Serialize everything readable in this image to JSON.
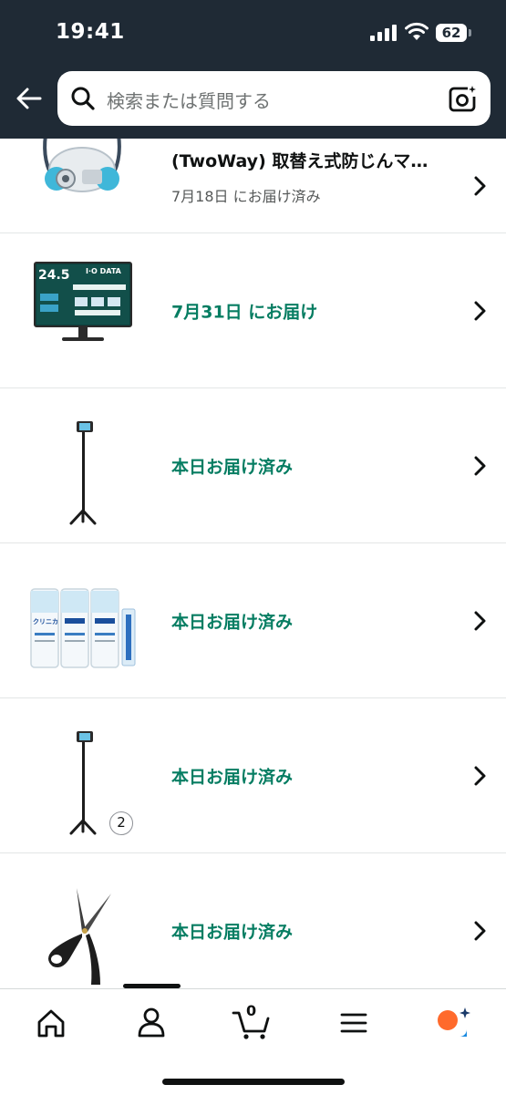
{
  "status_bar": {
    "time": "19:41",
    "battery": "62"
  },
  "search": {
    "placeholder": "検索または質問する"
  },
  "orders": [
    {
      "title": "(TwoWay) 取替え式防じんマ…",
      "status": "7月18日 にお届け済み"
    },
    {
      "status": "7月31日 にお届け"
    },
    {
      "status": "本日お届け済み"
    },
    {
      "status": "本日お届け済み"
    },
    {
      "status": "本日お届け済み",
      "quantity": "2"
    },
    {
      "status": "本日お届け済み"
    }
  ],
  "product_images": {
    "monitor_label": "24.5",
    "monitor_brand": "I·O DATA",
    "toothpaste_label": "クリニカ"
  },
  "nav": {
    "items": [
      "home-icon",
      "account-icon",
      "cart-icon",
      "menu-icon",
      "rufus-icon"
    ],
    "cart_count": "0"
  },
  "colors": {
    "header_bg": "#1f2a35",
    "delivered_text": "#067d62",
    "rufus_orange": "#ff6a2c",
    "rufus_blue": "#1a8ae0"
  }
}
